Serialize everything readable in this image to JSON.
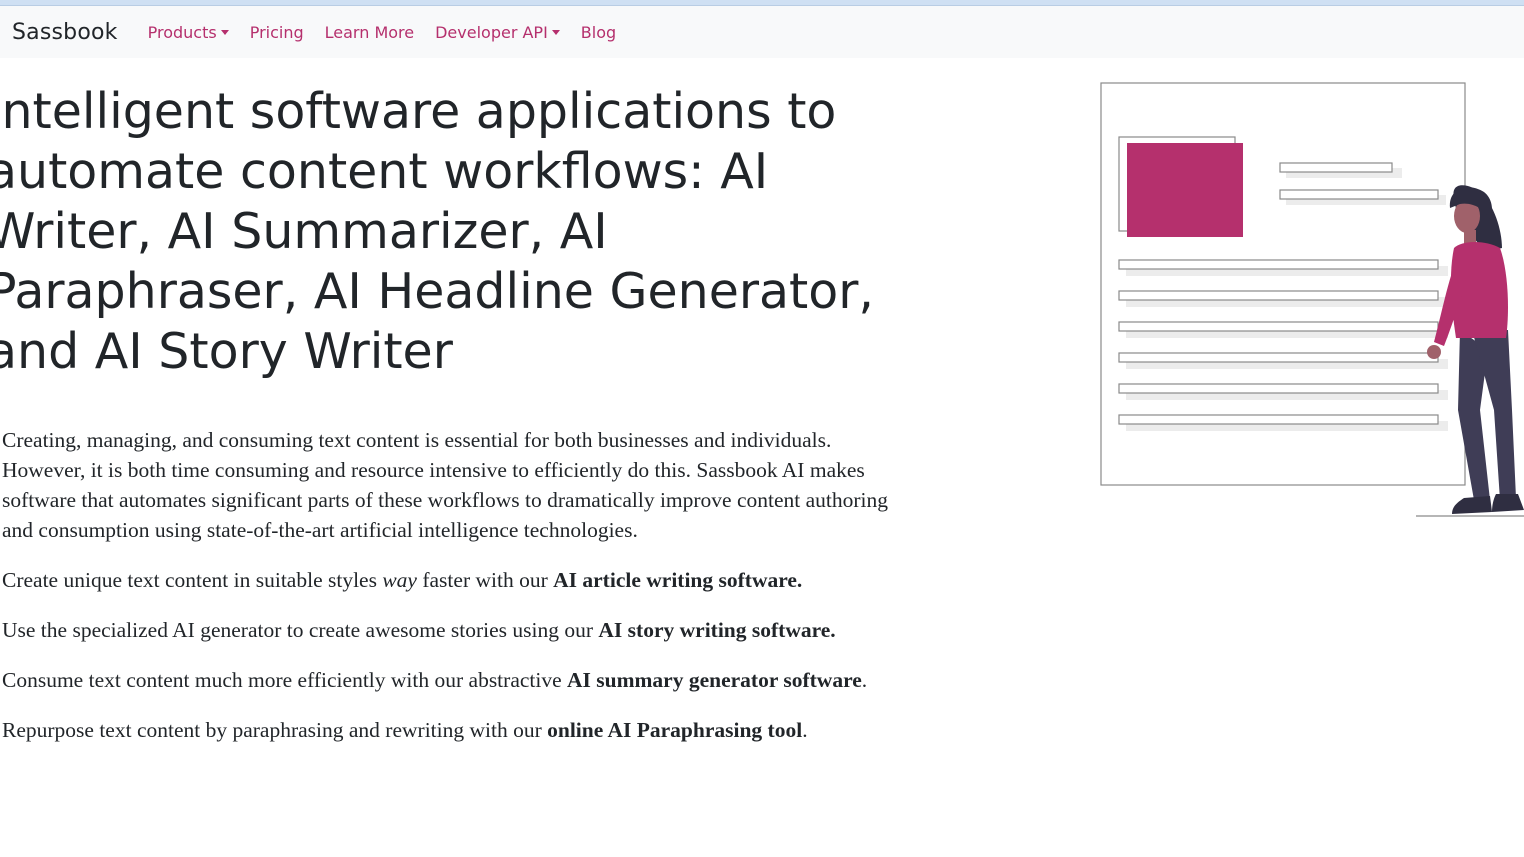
{
  "nav": {
    "brand": "Sassbook",
    "items": [
      {
        "label": "Products",
        "dropdown": true
      },
      {
        "label": "Pricing",
        "dropdown": false
      },
      {
        "label": "Learn More",
        "dropdown": false
      },
      {
        "label": "Developer API",
        "dropdown": true
      },
      {
        "label": "Blog",
        "dropdown": false
      }
    ]
  },
  "hero": {
    "title_lines": [
      "Intelligent software applications to",
      "automate content workflows: AI",
      "Writer, AI Summarizer, AI",
      "Paraphraser, AI Headline Generator,",
      "and AI Story Writer"
    ]
  },
  "content": {
    "intro": "Creating, managing, and consuming text content is essential for both businesses and individuals. However, it is both time consuming and resource intensive to efficiently do this. Sassbook AI makes software that automates significant parts of these workflows to dramatically improve content authoring and consumption using state-of-the-art artificial intelligence technologies.",
    "p2": {
      "before": "Create unique text content in suitable styles ",
      "em": "way",
      "after": " faster with our ",
      "strong": "AI article writing software."
    },
    "p3": {
      "before": "Use the specialized AI generator to create awesome stories using our ",
      "strong": "AI story writing software."
    },
    "p4": {
      "before": "Consume text content much more efficiently with our abstractive ",
      "strong": "AI summary generator software",
      "after": "."
    },
    "p5": {
      "before": "Repurpose text content by paraphrasing and rewriting with our ",
      "strong": "online AI Paraphrasing tool",
      "after": "."
    }
  },
  "colors": {
    "accent": "#b5306d",
    "text": "#212529",
    "navbar_bg": "#f8f9fa",
    "figure_dark": "#3f3d56",
    "figure_skin": "#a0616a"
  },
  "illustration": {
    "icon": "woman-with-document-illustration"
  }
}
